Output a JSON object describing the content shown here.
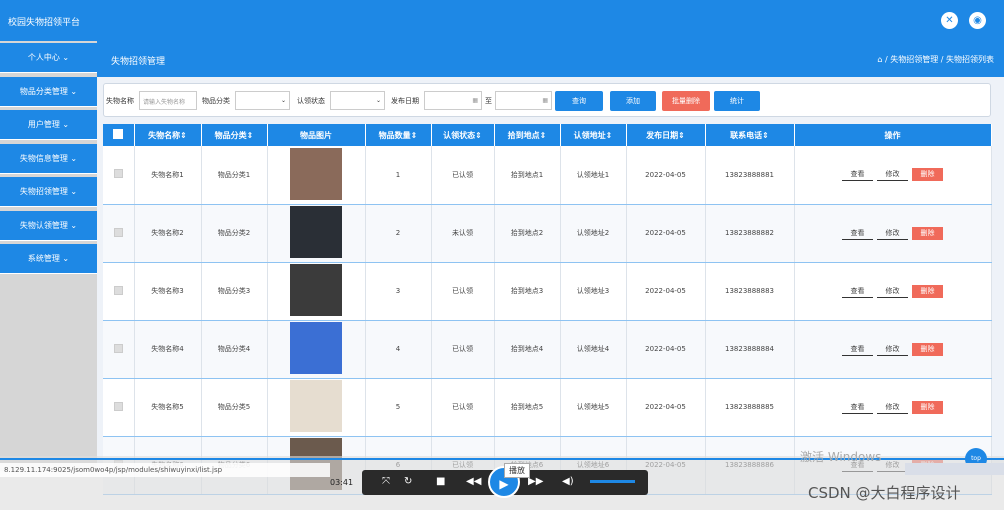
{
  "app": {
    "title": "校园失物招领平台",
    "close_icon": "close-icon",
    "user_icon": "user-icon"
  },
  "sidebar": {
    "items": [
      {
        "label": "个人中心"
      },
      {
        "label": "物品分类管理"
      },
      {
        "label": "用户管理"
      },
      {
        "label": "失物信息管理"
      },
      {
        "label": "失物招领管理"
      },
      {
        "label": "失物认领管理"
      },
      {
        "label": "系统管理"
      }
    ]
  },
  "page": {
    "title": "失物招领管理",
    "breadcrumb": "⌂ / 失物招领管理 / 失物招领列表"
  },
  "search": {
    "name_label": "失物名称",
    "name_placeholder": "请输入失物名称",
    "category_label": "物品分类",
    "status_label": "认领状态",
    "date_label": "发布日期",
    "to_label": "至",
    "query": "查询",
    "add": "添加",
    "batch_delete": "批量删除",
    "stats": "统计"
  },
  "table": {
    "columns": [
      "失物名称",
      "物品分类",
      "物品图片",
      "物品数量",
      "认领状态",
      "拾到地点",
      "认领地址",
      "发布日期",
      "联系电话",
      "操作"
    ],
    "rows": [
      {
        "name": "失物名称1",
        "category": "物品分类1",
        "qty": "1",
        "status": "已认领",
        "found": "拾到地点1",
        "claim": "认领地址1",
        "date": "2022-04-05",
        "phone": "13823888881"
      },
      {
        "name": "失物名称2",
        "category": "物品分类2",
        "qty": "2",
        "status": "未认领",
        "found": "拾到地点2",
        "claim": "认领地址2",
        "date": "2022-04-05",
        "phone": "13823888882"
      },
      {
        "name": "失物名称3",
        "category": "物品分类3",
        "qty": "3",
        "status": "已认领",
        "found": "拾到地点3",
        "claim": "认领地址3",
        "date": "2022-04-05",
        "phone": "13823888883"
      },
      {
        "name": "失物名称4",
        "category": "物品分类4",
        "qty": "4",
        "status": "已认领",
        "found": "拾到地点4",
        "claim": "认领地址4",
        "date": "2022-04-05",
        "phone": "13823888884"
      },
      {
        "name": "失物名称5",
        "category": "物品分类5",
        "qty": "5",
        "status": "已认领",
        "found": "拾到地点5",
        "claim": "认领地址5",
        "date": "2022-04-05",
        "phone": "13823888885"
      },
      {
        "name": "失物名称6",
        "category": "物品分类6",
        "qty": "6",
        "status": "已认领",
        "found": "拾到地点6",
        "claim": "认领地址6",
        "date": "2022-04-05",
        "phone": "13823888886"
      }
    ],
    "actions": {
      "view": "查看",
      "edit": "修改",
      "delete": "删除"
    }
  },
  "player": {
    "time": "03:41",
    "tooltip": "播放",
    "url": "8.129.11.174:9025/jsom0wo4p/jsp/modules/shiwuyinxi/list.jsp"
  },
  "watermark": "激活 Windows",
  "csdn": "CSDN @大白程序设计",
  "fab": "top"
}
